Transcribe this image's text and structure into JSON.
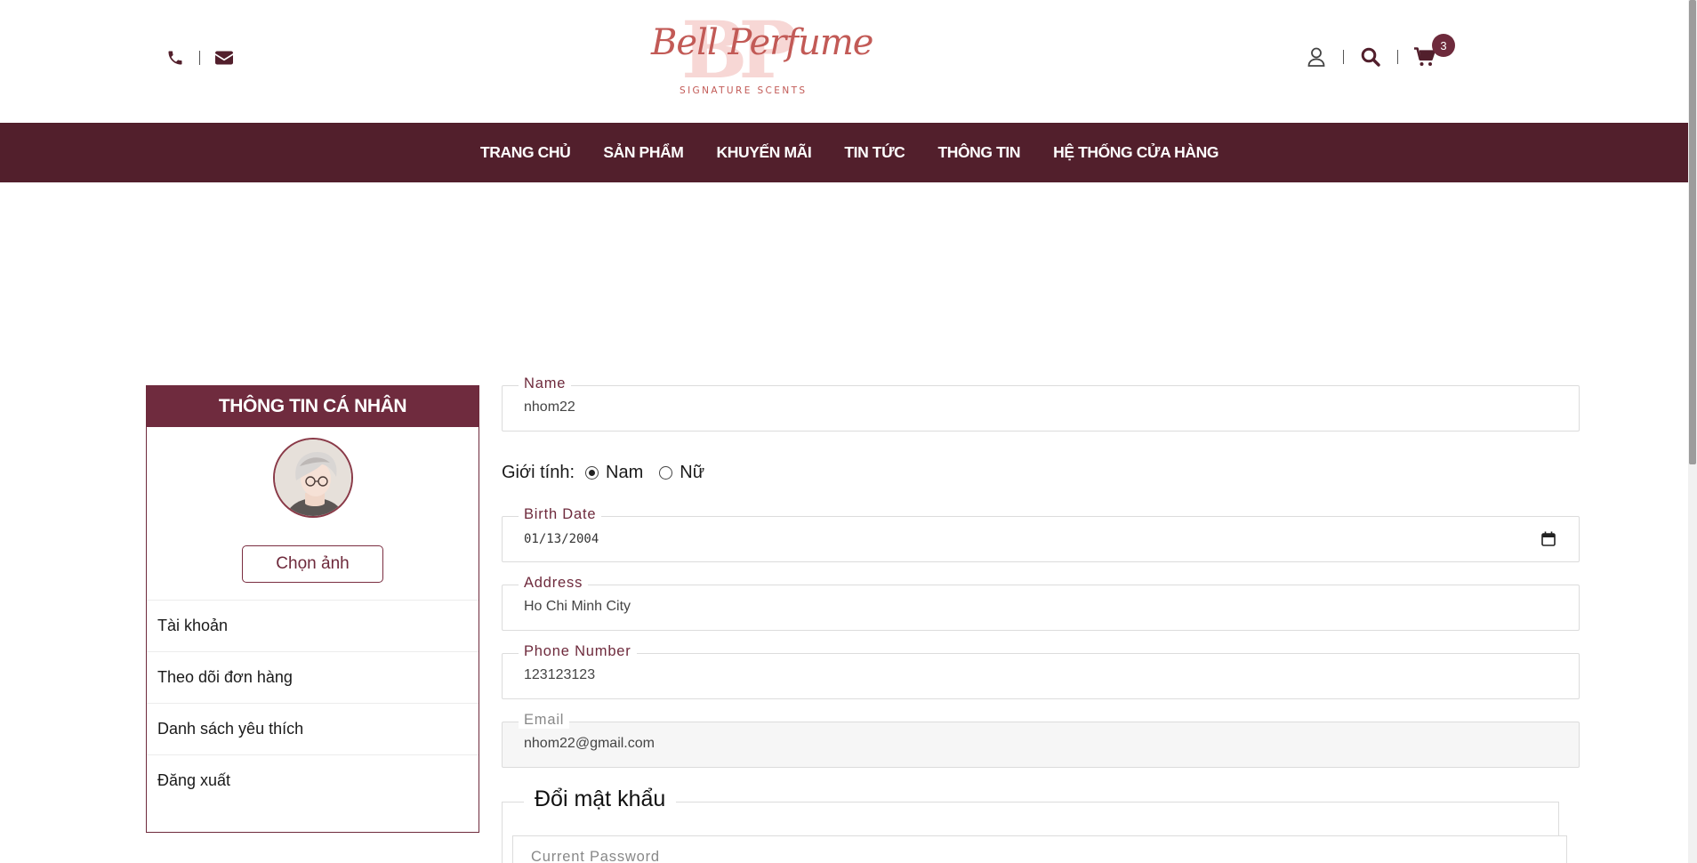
{
  "header": {
    "logo_text": "Bell Perfume",
    "logo_monogram": "BP",
    "logo_tagline": "SIGNATURE SCENTS",
    "cart_count": "3",
    "icons": [
      "phone-icon",
      "envelope-icon",
      "user-icon",
      "search-icon",
      "cart-icon"
    ]
  },
  "nav": {
    "items": [
      {
        "label": "TRANG CHỦ"
      },
      {
        "label": "SẢN PHẨM"
      },
      {
        "label": "KHUYẾN MÃI"
      },
      {
        "label": "TIN TỨC"
      },
      {
        "label": "THÔNG TIN"
      },
      {
        "label": "HỆ THỐNG CỬA HÀNG"
      }
    ]
  },
  "sidebar": {
    "title": "THÔNG TIN CÁ NHÂN",
    "choose_photo": "Chọn ảnh",
    "items": [
      {
        "label": "Tài khoản"
      },
      {
        "label": "Theo dõi đơn hàng"
      },
      {
        "label": "Danh sách yêu thích"
      },
      {
        "label": "Đăng xuất"
      }
    ]
  },
  "form": {
    "name": {
      "label": "Name",
      "value": "nhom22"
    },
    "gender": {
      "label": "Giới tính:",
      "options": [
        "Nam",
        "Nữ"
      ],
      "selected": "Nam"
    },
    "birth_date": {
      "label": "Birth Date",
      "value": "01/13/2004"
    },
    "address": {
      "label": "Address",
      "value": "Ho Chi Minh City"
    },
    "phone": {
      "label": "Phone Number",
      "value": "123123123"
    },
    "email": {
      "label": "Email",
      "value": "nhom22@gmail.com"
    }
  },
  "password": {
    "title": "Đổi mật khẩu",
    "current_label": "Current Password"
  },
  "colors": {
    "brand": "#521f2c",
    "panel_header": "#6f2b3e",
    "logo_accent": "#c25a56"
  }
}
